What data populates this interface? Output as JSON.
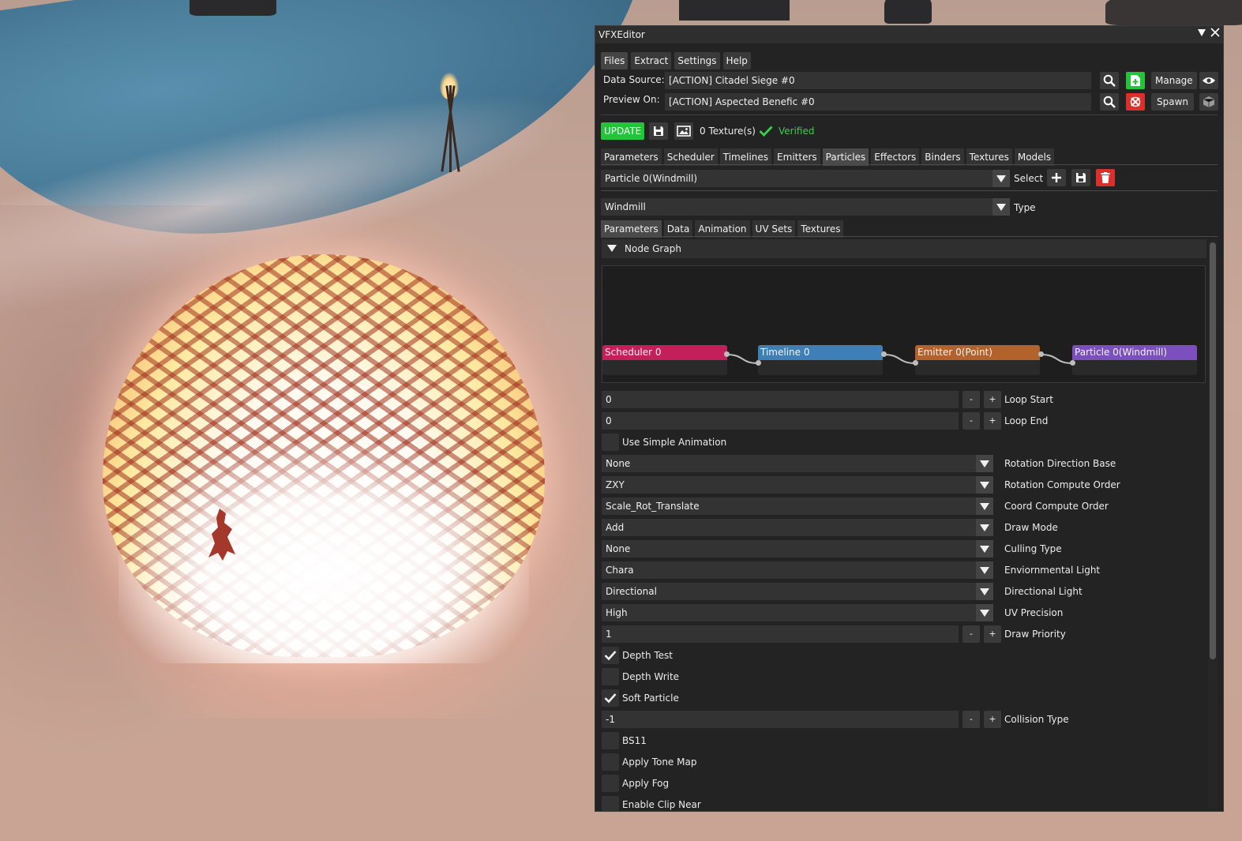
{
  "window": {
    "title": "VFXEditor"
  },
  "menu": [
    "Files",
    "Extract",
    "Settings",
    "Help"
  ],
  "source": {
    "data_source_label": "Data Source:",
    "data_source_value": "[ACTION] Citadel Siege #0",
    "preview_on_label": "Preview On:",
    "preview_on_value": "[ACTION] Aspected Benefic #0",
    "manage_label": "Manage",
    "spawn_label": "Spawn"
  },
  "toolbar": {
    "update_label": "UPDATE",
    "texture_count": "0 Texture(s)",
    "verified_label": "Verified"
  },
  "main_tabs": {
    "items": [
      "Parameters",
      "Scheduler",
      "Timelines",
      "Emitters",
      "Particles",
      "Effectors",
      "Binders",
      "Textures",
      "Models"
    ],
    "active": "Particles"
  },
  "particle_select": {
    "value": "Particle 0(Windmill)",
    "label": "Select"
  },
  "particle_type": {
    "value": "Windmill",
    "label": "Type"
  },
  "sub_tabs": {
    "items": [
      "Parameters",
      "Data",
      "Animation",
      "UV Sets",
      "Textures"
    ],
    "active": "Parameters"
  },
  "node_graph": {
    "title": "Node Graph",
    "nodes": [
      {
        "label": "Scheduler 0",
        "color": "#c41f59"
      },
      {
        "label": "Timeline 0",
        "color": "#3d7fb6"
      },
      {
        "label": "Emitter 0(Point)",
        "color": "#b4622b"
      },
      {
        "label": "Particle 0(Windmill)",
        "color": "#7b4fbd"
      }
    ]
  },
  "params": {
    "loop_start": {
      "value": "0",
      "label": "Loop Start"
    },
    "loop_end": {
      "value": "0",
      "label": "Loop End"
    },
    "use_simple_animation": {
      "label": "Use Simple Animation",
      "checked": false
    },
    "rotation_direction_base": {
      "value": "None",
      "label": "Rotation Direction Base"
    },
    "rotation_compute_order": {
      "value": "ZXY",
      "label": "Rotation Compute Order"
    },
    "coord_compute_order": {
      "value": "Scale_Rot_Translate",
      "label": "Coord Compute Order"
    },
    "draw_mode": {
      "value": "Add",
      "label": "Draw Mode"
    },
    "culling_type": {
      "value": "None",
      "label": "Culling Type"
    },
    "environmental_light": {
      "value": "Chara",
      "label": "Enviornmental Light"
    },
    "directional_light": {
      "value": "Directional",
      "label": "Directional Light"
    },
    "uv_precision": {
      "value": "High",
      "label": "UV Precision"
    },
    "draw_priority": {
      "value": "1",
      "label": "Draw Priority"
    },
    "depth_test": {
      "label": "Depth Test",
      "checked": true
    },
    "depth_write": {
      "label": "Depth Write",
      "checked": false
    },
    "soft_particle": {
      "label": "Soft Particle",
      "checked": true
    },
    "collision_type": {
      "value": "-1",
      "label": "Collision Type"
    },
    "bs11": {
      "label": "BS11",
      "checked": false
    },
    "apply_tone_map": {
      "label": "Apply Tone Map",
      "checked": false
    },
    "apply_fog": {
      "label": "Apply Fog",
      "checked": false
    },
    "enable_clip_near": {
      "label": "Enable Clip Near",
      "checked": false
    }
  },
  "stepper": {
    "minus": "-",
    "plus": "+"
  },
  "colors": {
    "accent_green": "#23c33a",
    "danger_red": "#d9302c",
    "verified_green": "#39d14b",
    "panel_bg": "#232323"
  }
}
